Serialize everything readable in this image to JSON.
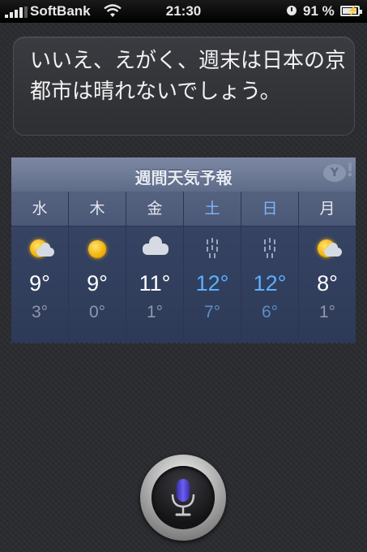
{
  "status_bar": {
    "carrier": "SoftBank",
    "time": "21:30",
    "battery": "91 %"
  },
  "assistant": {
    "response_text": "いいえ、えがく、週末は日本の京都市は晴れないでしょう。"
  },
  "weather": {
    "title": "週間天気予報",
    "provider_logo": "Y!",
    "days": [
      {
        "name": "水",
        "condition": "sun-cloud-icon",
        "high": "9°",
        "low": "3°",
        "weekend": false
      },
      {
        "name": "木",
        "condition": "sun-icon",
        "high": "9°",
        "low": "0°",
        "weekend": false
      },
      {
        "name": "金",
        "condition": "cloud-icon",
        "high": "11°",
        "low": "1°",
        "weekend": false
      },
      {
        "name": "土",
        "condition": "rain-icon",
        "high": "12°",
        "low": "7°",
        "weekend": true
      },
      {
        "name": "日",
        "condition": "rain-icon",
        "high": "12°",
        "low": "6°",
        "weekend": true
      },
      {
        "name": "月",
        "condition": "sun-cloud-icon",
        "high": "8°",
        "low": "1°",
        "weekend": false
      }
    ]
  },
  "colors": {
    "weekend_accent": "#5ab0ff",
    "mic_accent": "#5a4fd6"
  }
}
